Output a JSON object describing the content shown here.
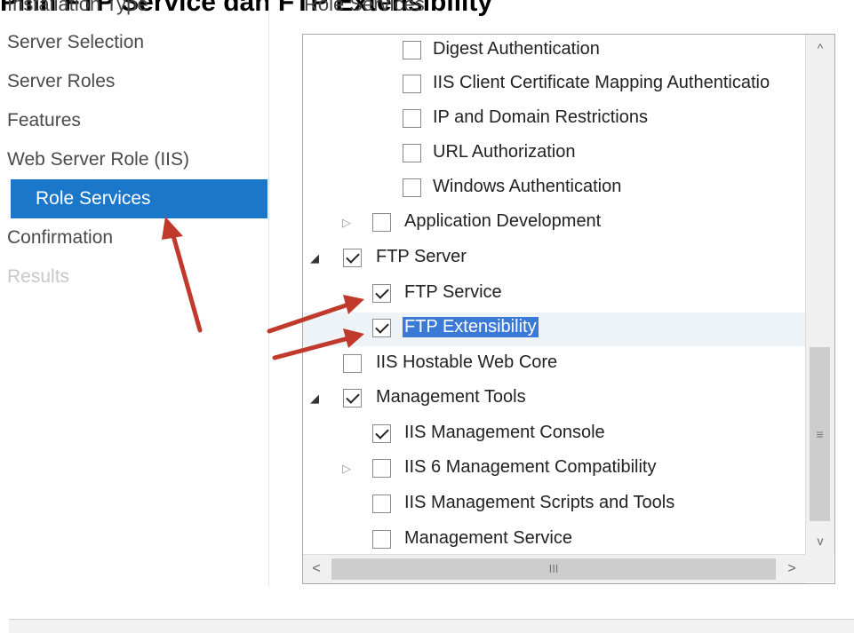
{
  "caption": "Pilih FTP Service dan FTP Extensibility",
  "nav_top_partial": "Installation Type",
  "header_partial": "Role Services",
  "nav": [
    {
      "label": "Server Selection",
      "state": "normal"
    },
    {
      "label": "Server Roles",
      "state": "normal"
    },
    {
      "label": "Features",
      "state": "normal"
    },
    {
      "label": "Web Server Role (IIS)",
      "state": "normal"
    },
    {
      "label": "Role Services",
      "state": "selected"
    },
    {
      "label": "Confirmation",
      "state": "normal"
    },
    {
      "label": "Results",
      "state": "disabled"
    }
  ],
  "tree": [
    {
      "label": "Digest Authentication",
      "level": 3,
      "checked": false
    },
    {
      "label": "IIS Client Certificate Mapping Authenticatio",
      "level": 3,
      "checked": false
    },
    {
      "label": "IP and Domain Restrictions",
      "level": 3,
      "checked": false
    },
    {
      "label": "URL Authorization",
      "level": 3,
      "checked": false
    },
    {
      "label": "Windows Authentication",
      "level": 3,
      "checked": false
    },
    {
      "label": "Application Development",
      "level": 2,
      "checked": false,
      "expander": "collapsed"
    },
    {
      "label": "FTP Server",
      "level": 1,
      "checked": true,
      "expander": "expanded"
    },
    {
      "label": "FTP Service",
      "level": 2,
      "checked": true
    },
    {
      "label": "FTP Extensibility",
      "level": 2,
      "checked": true,
      "selected": true
    },
    {
      "label": "IIS Hostable Web Core",
      "level": 1,
      "checked": false
    },
    {
      "label": "Management Tools",
      "level": 1,
      "checked": true,
      "expander": "expanded"
    },
    {
      "label": "IIS Management Console",
      "level": 2,
      "checked": true
    },
    {
      "label": "IIS 6 Management Compatibility",
      "level": 2,
      "checked": false,
      "expander": "collapsed"
    },
    {
      "label": "IIS Management Scripts and Tools",
      "level": 2,
      "checked": false
    },
    {
      "label": "Management Service",
      "level": 2,
      "checked": false
    }
  ],
  "scrollbar_glyphs": {
    "up": "^",
    "down": "v",
    "left": "<",
    "right": ">",
    "grip_v": "≡",
    "grip_h": "III"
  },
  "colors": {
    "selection": "#1b77c9",
    "annotation_arrow": "#c0392b"
  }
}
